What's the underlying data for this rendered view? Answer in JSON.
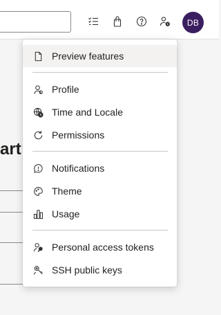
{
  "header": {
    "user_initials": "DB",
    "icons": [
      "checklist-icon",
      "shopping-bag-icon",
      "help-icon",
      "user-settings-icon"
    ]
  },
  "page": {
    "heading_fragment": "art"
  },
  "user_menu": {
    "groups": [
      [
        {
          "label": "Preview features",
          "icon": "document-icon"
        }
      ],
      [
        {
          "label": "Profile",
          "icon": "profile-icon"
        },
        {
          "label": "Time and Locale",
          "icon": "globe-clock-icon"
        },
        {
          "label": "Permissions",
          "icon": "refresh-icon"
        }
      ],
      [
        {
          "label": "Notifications",
          "icon": "chat-bubble-icon"
        },
        {
          "label": "Theme",
          "icon": "paint-icon"
        },
        {
          "label": "Usage",
          "icon": "bar-chart-icon"
        }
      ],
      [
        {
          "label": "Personal access tokens",
          "icon": "person-key-icon"
        },
        {
          "label": "SSH public keys",
          "icon": "key-chain-icon"
        }
      ]
    ]
  },
  "colors": {
    "avatar_bg": "#3b1e5f",
    "menu_hover": "#f3f2f1",
    "icon_stroke": "#323130"
  }
}
